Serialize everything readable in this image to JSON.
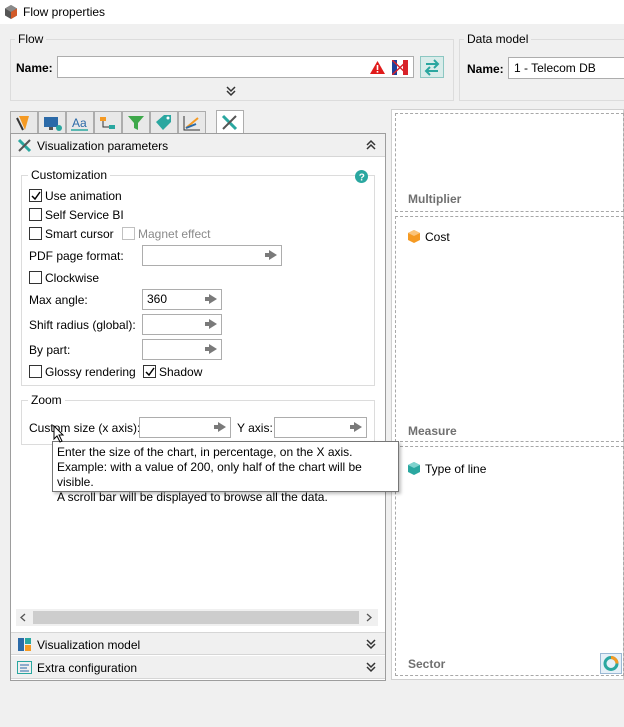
{
  "window": {
    "title": "Flow properties"
  },
  "flow": {
    "legend": "Flow",
    "name_label": "Name:",
    "name_value": ""
  },
  "data_model": {
    "legend": "Data model",
    "name_label": "Name:",
    "name_value": "1 - Telecom DB"
  },
  "tabs": [
    {
      "icon": "chart-type-icon"
    },
    {
      "icon": "display-icon"
    },
    {
      "icon": "text-style-icon"
    },
    {
      "icon": "data-flow-icon"
    },
    {
      "icon": "filter-icon"
    },
    {
      "icon": "tag-icon"
    },
    {
      "icon": "axis-chart-icon"
    },
    {
      "icon": "tools-icon",
      "active": true
    }
  ],
  "sections": {
    "visualization_parameters": "Visualization parameters",
    "visualization_model": "Visualization model",
    "extra_configuration": "Extra configuration"
  },
  "customization": {
    "legend": "Customization",
    "use_animation": {
      "label": "Use animation",
      "checked": true
    },
    "self_service_bi": {
      "label": "Self Service BI",
      "checked": false
    },
    "smart_cursor": {
      "label": "Smart cursor",
      "checked": false
    },
    "magnet_effect": {
      "label": "Magnet effect",
      "checked": false,
      "disabled": true
    },
    "pdf_page_format": {
      "label": "PDF page format:",
      "value": ""
    },
    "clockwise": {
      "label": "Clockwise",
      "checked": false
    },
    "max_angle": {
      "label": "Max angle:",
      "value": "360"
    },
    "shift_radius": {
      "label": "Shift radius (global):",
      "value": ""
    },
    "by_part": {
      "label": "By part:",
      "value": ""
    },
    "glossy_rendering": {
      "label": "Glossy rendering",
      "checked": false
    },
    "shadow": {
      "label": "Shadow",
      "checked": true
    }
  },
  "zoom": {
    "legend": "Zoom",
    "custom_size_label": "Custom size (x axis):",
    "custom_size_value": "",
    "y_axis_label": "Y axis:",
    "y_axis_value": ""
  },
  "tooltip": {
    "line1": "Enter the size of the chart, in percentage, on the X axis.",
    "line2": "Example: with a value of 200, only half of the chart will be visible.",
    "line3": "A scroll bar will be displayed to browse all the data."
  },
  "dropzones": {
    "multiplier": {
      "title": "Multiplier",
      "items": []
    },
    "measure": {
      "title": "Measure",
      "items": [
        "Cost"
      ]
    },
    "sector": {
      "title": "Sector",
      "items": [
        "Type of line"
      ]
    }
  },
  "colors": {
    "accent_teal": "#2aa7a0",
    "measure_orange": "#f59a23",
    "warning_red": "#e01b1b"
  }
}
